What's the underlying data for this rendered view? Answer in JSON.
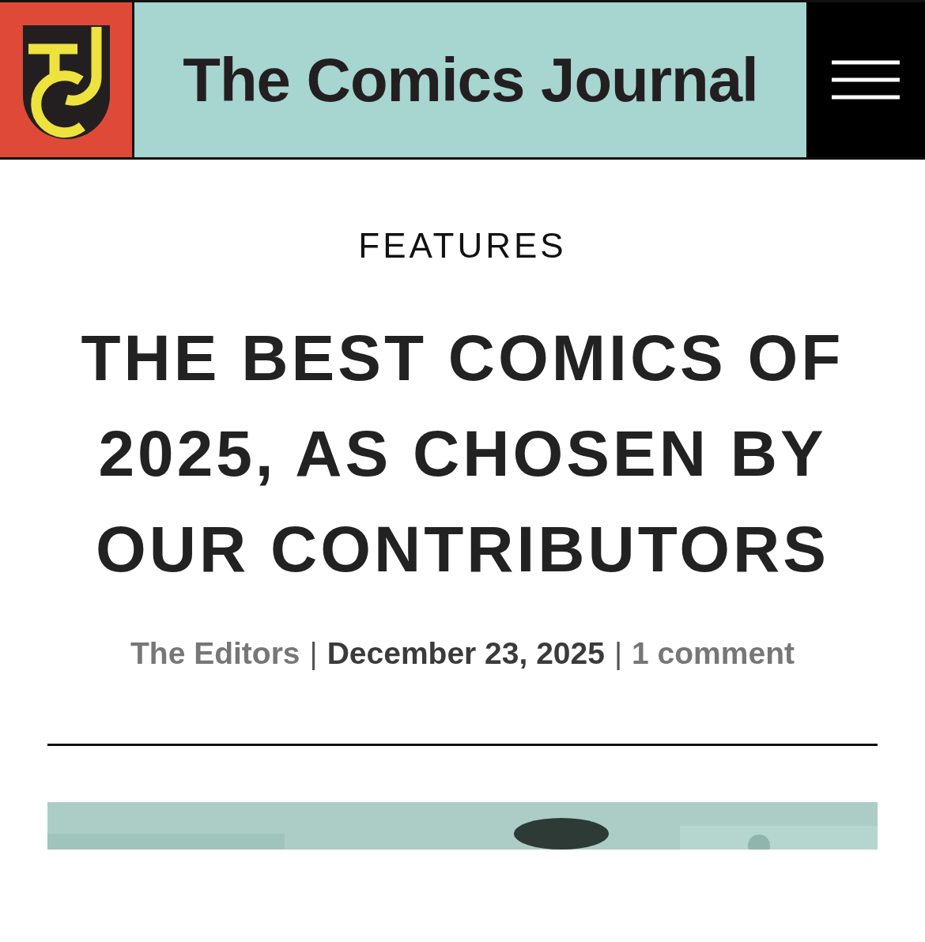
{
  "header": {
    "site_title": "The Comics Journal"
  },
  "article": {
    "category": "FEATURES",
    "title": "THE BEST COMICS OF 2025, AS CHOSEN BY OUR CONTRIBUTORS",
    "byline": {
      "author": "The Editors",
      "date": "December 23, 2025",
      "comments": "1 comment",
      "separator": "|"
    }
  }
}
